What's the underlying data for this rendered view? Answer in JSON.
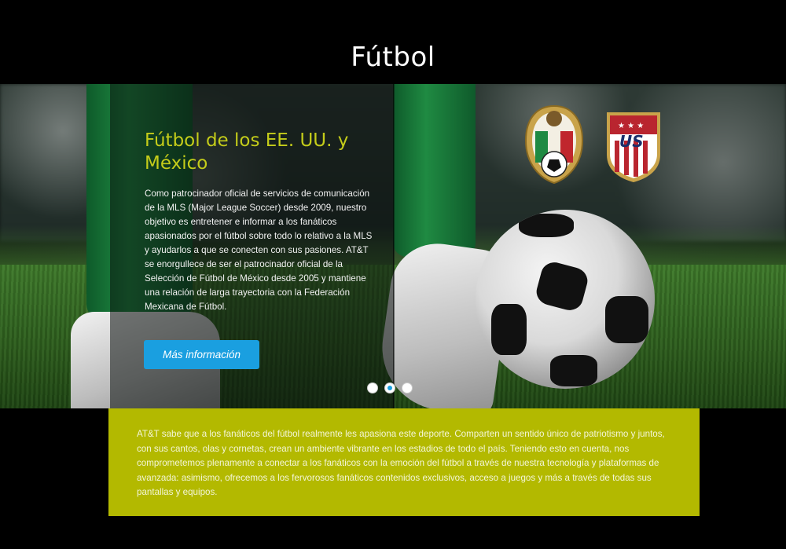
{
  "page": {
    "title": "Fútbol"
  },
  "hero": {
    "heading": "Fútbol de los EE. UU. y México",
    "body": "Como patrocinador oficial de servicios de comunicación de la MLS (Major League Soccer) desde 2009, nuestro objetivo es entretener e informar a los fanáticos apasionados por el fútbol sobre todo lo relativo a la MLS y ayudarlos a que se conecten con sus pasiones. AT&T se enorgullece de ser el patrocinador oficial de la Selección de Fútbol de México desde 2005 y mantiene una relación de larga trayectoria con la Federación Mexicana de Fútbol.",
    "cta_label": "Más información",
    "carousel": {
      "slide_count": 3,
      "active_index": 1
    },
    "crests": [
      "mexico-federation-crest",
      "us-soccer-crest"
    ],
    "crest_us_letters": "US"
  },
  "info": {
    "text": "AT&T sabe que a los fanáticos del fútbol realmente les apasiona este deporte. Comparten un sentido único de patriotismo y juntos, con sus cantos, olas y cornetas, crean un ambiente vibrante en los estadios de todo el país. Teniendo esto en cuenta, nos comprometemos plenamente a conectar a los fanáticos con la emoción del fútbol a través de nuestra tecnología y plataformas de avanzada: asimismo, ofrecemos a los fervorosos fanáticos contenidos exclusivos, acceso a juegos y más a través de todas sus pantallas y equipos."
  },
  "colors": {
    "background": "#000000",
    "heading_accent": "#c4cc1a",
    "cta": "#1a9fe0",
    "info_box": "#b3b900"
  }
}
